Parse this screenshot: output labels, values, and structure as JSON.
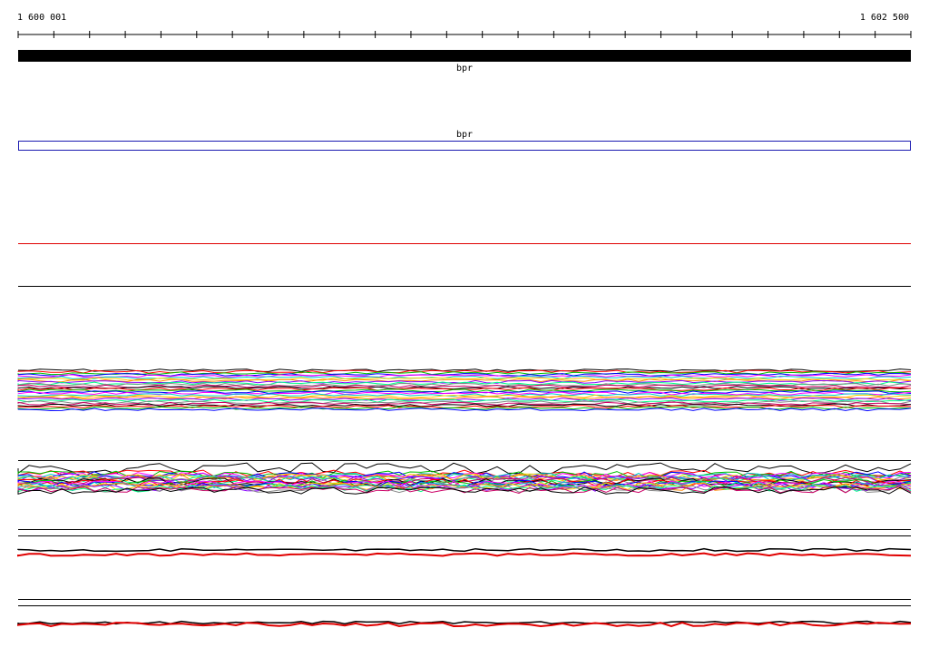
{
  "ruler": {
    "start_label": "1 600 001",
    "end_label": "1 602 500"
  },
  "tracks": {
    "gene_track_label": "bpr",
    "feature_track_label": "bpr"
  },
  "colors": {
    "gene_bar": "#000000",
    "feature_box": "#1a1ab0",
    "accent_line": "#e00000",
    "palette": [
      "#000000",
      "#ff0000",
      "#00c000",
      "#0000ff",
      "#ff00ff",
      "#00cccc",
      "#ffcc00",
      "#ff8800",
      "#8800ff",
      "#00ff88",
      "#888888",
      "#cc0066"
    ]
  }
}
